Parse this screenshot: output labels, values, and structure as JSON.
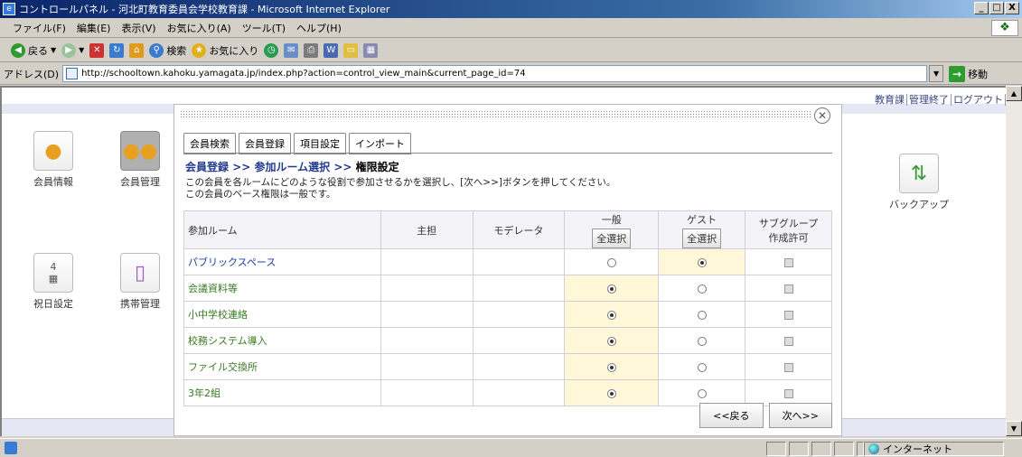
{
  "window": {
    "title": "コントロールパネル - 河北町教育委員会学校教育課 - Microsoft Internet Explorer",
    "buttons": [
      "_",
      "□",
      "X"
    ]
  },
  "menu": [
    "ファイル(F)",
    "編集(E)",
    "表示(V)",
    "お気に入り(A)",
    "ツール(T)",
    "ヘルプ(H)"
  ],
  "toolbar": {
    "back_label": "戻る",
    "search_label": "検索",
    "favorites_label": "お気に入り"
  },
  "address": {
    "label": "アドレス(D)",
    "url": "http://schooltown.kahoku.yamagata.jp/index.php?action=control_view_main&current_page_id=74",
    "go_label": "移動"
  },
  "header_links": [
    "教育課",
    "管理終了",
    "ログアウト"
  ],
  "apps": {
    "left": [
      {
        "label": "会員情報",
        "icon": "person-icon"
      },
      {
        "label": "会員管理",
        "icon": "group-icon"
      },
      {
        "label": "祝日設定",
        "icon": "calendar-icon"
      },
      {
        "label": "携帯管理",
        "icon": "mobile-icon"
      }
    ],
    "right": [
      {
        "label": "バックアップ",
        "icon": "backup-icon"
      }
    ]
  },
  "modal": {
    "tabs": [
      "会員検索",
      "会員登録",
      "項目設定",
      "インポート"
    ],
    "active_tab": "会員登録",
    "breadcrumb": {
      "step1": "会員登録",
      "sep": ">>",
      "step2": "参加ルーム選択",
      "step3": "権限設定"
    },
    "description_line1": "この会員を各ルームにどのような役割で参加させるかを選択し、[次へ>>]ボタンを押してください。",
    "description_line2": "この会員のベース権限は一般です。",
    "columns": {
      "room": "参加ルーム",
      "owner": "主担",
      "moderator": "モデレータ",
      "general": "一般",
      "guest": "ゲスト",
      "subgroup": "サブグループ作成許可",
      "select_all": "全選択"
    },
    "rows": [
      {
        "room": "パブリックスペース",
        "role": "guest"
      },
      {
        "room": "会議資料等",
        "role": "general"
      },
      {
        "room": "小中学校連絡",
        "role": "general"
      },
      {
        "room": "校務システム導入",
        "role": "general"
      },
      {
        "room": "ファイル交換所",
        "role": "general"
      },
      {
        "room": "3年2組",
        "role": "general"
      }
    ],
    "back_button": "<<戻る",
    "next_button": "次へ>>"
  },
  "status": {
    "zone": "インターネット"
  }
}
